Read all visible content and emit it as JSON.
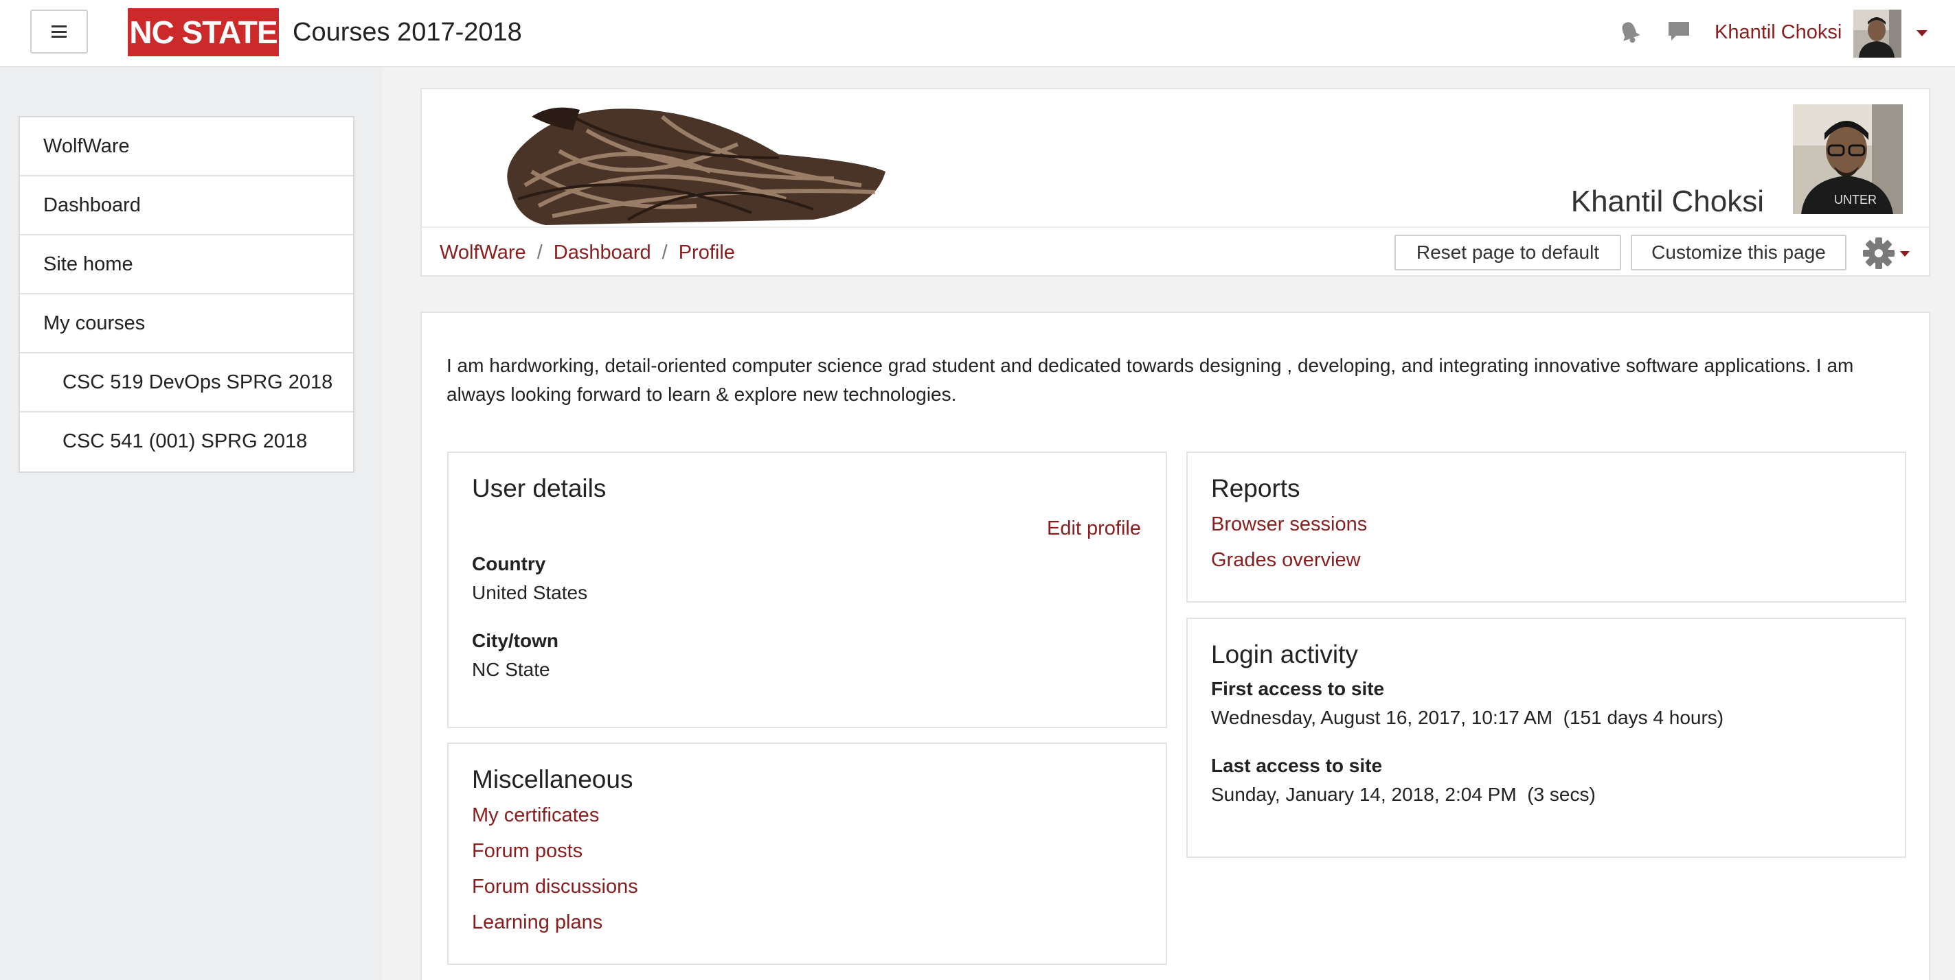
{
  "navbar": {
    "menu_toggle_label": "Menu",
    "logo_text": "NC STATE",
    "site_title": "Courses 2017-2018",
    "user_name": "Khantil Choksi"
  },
  "sidebar": {
    "items": [
      {
        "label": "WolfWare"
      },
      {
        "label": "Dashboard"
      },
      {
        "label": "Site home"
      },
      {
        "label": "My courses"
      },
      {
        "label": "CSC 519 DevOps SPRG 2018"
      },
      {
        "label": "CSC 541 (001) SPRG 2018"
      }
    ]
  },
  "header": {
    "profile_name": "Khantil Choksi",
    "breadcrumb": [
      "WolfWare",
      "Dashboard",
      "Profile"
    ],
    "breadcrumb_separator": "/",
    "reset_button": "Reset page to default",
    "customize_button": "Customize this page"
  },
  "bio": "I am hardworking, detail-oriented computer science grad student and dedicated towards designing , developing, and integrating innovative software applications. I am always looking forward to learn & explore new technologies.",
  "user_details": {
    "title": "User details",
    "edit_link": "Edit profile",
    "country_label": "Country",
    "country_value": "United States",
    "city_label": "City/town",
    "city_value": "NC State"
  },
  "miscellaneous": {
    "title": "Miscellaneous",
    "links": [
      "My certificates",
      "Forum posts",
      "Forum discussions",
      "Learning plans"
    ]
  },
  "reports": {
    "title": "Reports",
    "links": [
      "Browser sessions",
      "Grades overview"
    ]
  },
  "login_activity": {
    "title": "Login activity",
    "first_label": "First access to site",
    "first_value": "Wednesday, August 16, 2017, 10:17 AM  (151 days 4 hours)",
    "last_label": "Last access to site",
    "last_value": "Sunday, January 14, 2018, 2:04 PM  (3 secs)"
  },
  "colors": {
    "brand_red": "#cc2a2a",
    "link": "#8a1d1d",
    "page_bg": "#f2f2f2"
  },
  "icons": [
    "menu-icon",
    "notification-bell-icon",
    "messages-icon",
    "caret-down-icon",
    "gear-icon"
  ]
}
